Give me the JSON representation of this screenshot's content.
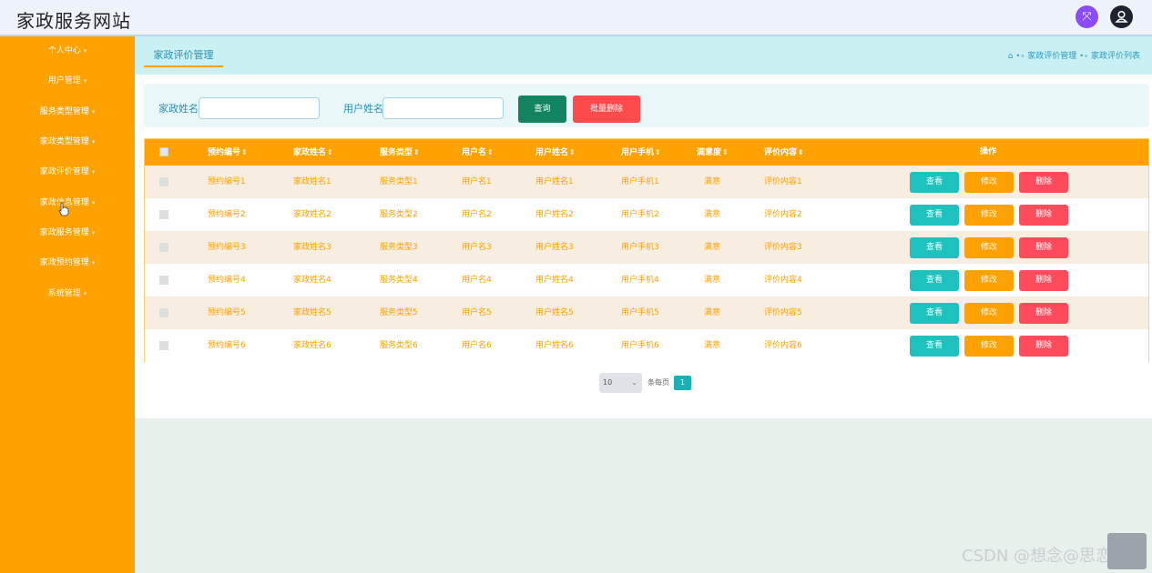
{
  "header": {
    "title": "家政服务网站",
    "expand_icon": "expand-icon",
    "user_icon": "user-icon"
  },
  "sidebar": {
    "items": [
      {
        "label": "个人中心"
      },
      {
        "label": "用户管理"
      },
      {
        "label": "服务类型管理"
      },
      {
        "label": "家政类型管理"
      },
      {
        "label": "家政评价管理"
      },
      {
        "label": "家政信息管理"
      },
      {
        "label": "家政服务管理"
      },
      {
        "label": "家政预约管理"
      },
      {
        "label": "系统管理"
      }
    ]
  },
  "tabs": {
    "active": "家政评价管理"
  },
  "breadcrumb": {
    "home_icon": "home-icon",
    "level1": "家政评价管理",
    "level2": "家政评价列表"
  },
  "search": {
    "label1": "家政姓名",
    "label2": "用户姓名",
    "query_button": "查询",
    "batch_delete_button": "批量删除"
  },
  "table": {
    "columns": [
      "预约编号",
      "家政姓名",
      "服务类型",
      "用户名",
      "用户姓名",
      "用户手机",
      "满意度",
      "评价内容",
      "操作"
    ],
    "rows": [
      [
        "预约编号1",
        "家政姓名1",
        "服务类型1",
        "用户名1",
        "用户姓名1",
        "用户手机1",
        "满意",
        "评价内容1"
      ],
      [
        "预约编号2",
        "家政姓名2",
        "服务类型2",
        "用户名2",
        "用户姓名2",
        "用户手机2",
        "满意",
        "评价内容2"
      ],
      [
        "预约编号3",
        "家政姓名3",
        "服务类型3",
        "用户名3",
        "用户姓名3",
        "用户手机3",
        "满意",
        "评价内容3"
      ],
      [
        "预约编号4",
        "家政姓名4",
        "服务类型4",
        "用户名4",
        "用户姓名4",
        "用户手机4",
        "满意",
        "评价内容4"
      ],
      [
        "预约编号5",
        "家政姓名5",
        "服务类型5",
        "用户名5",
        "用户姓名5",
        "用户手机5",
        "满意",
        "评价内容5"
      ],
      [
        "预约编号6",
        "家政姓名6",
        "服务类型6",
        "用户名6",
        "用户姓名6",
        "用户手机6",
        "满意",
        "评价内容6"
      ]
    ],
    "actions": {
      "view": "查看",
      "edit": "修改",
      "delete": "删除"
    }
  },
  "pagination": {
    "page_size": "10",
    "label": "条每页",
    "current_page": "1"
  },
  "watermark": {
    "text": "CSDN @想念@思恋"
  },
  "colors": {
    "accent": "#ffa200",
    "tab_bg": "#c9f0f2",
    "view": "#1ec2bd",
    "delete": "#ff4b5c",
    "query": "#14835f"
  }
}
